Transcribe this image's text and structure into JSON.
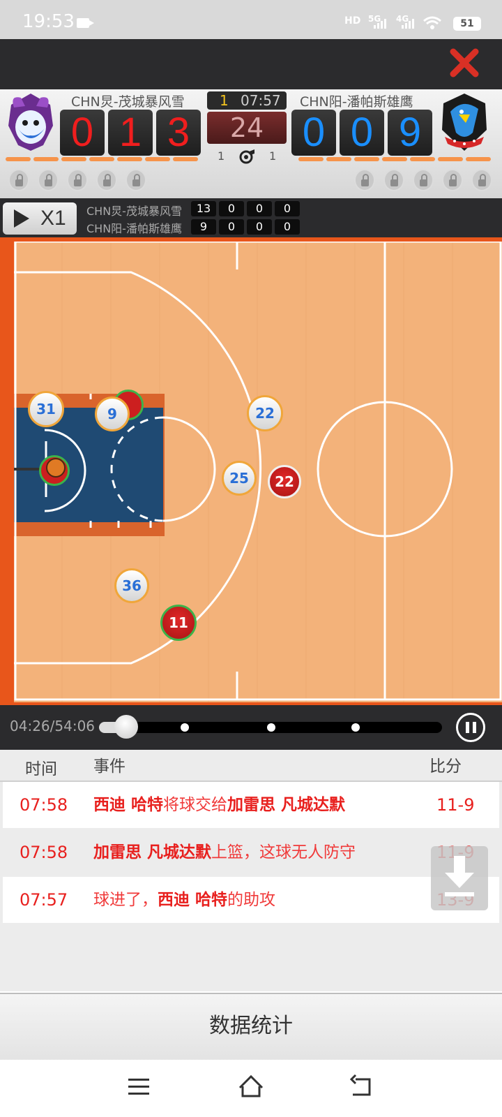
{
  "status_bar": {
    "time": "19:53",
    "hd": "HD",
    "net1": "5G",
    "net2": "4G",
    "battery": "51"
  },
  "header": {
    "close_icon": "close-x-icon"
  },
  "scoreboard": {
    "home": {
      "name": "CHN炅-茂城暴风雪",
      "digits": [
        "0",
        "1",
        "3"
      ],
      "color": "#f01e1e",
      "logo_icon": "purple-wolf-logo-icon"
    },
    "away": {
      "name": "CHN阳-潘帕斯雄鹰",
      "digits": [
        "0",
        "0",
        "9"
      ],
      "color": "#1a8fff",
      "logo_icon": "blue-eagle-logo-icon"
    },
    "quarter": "1",
    "game_clock": "07:57",
    "shot_clock": "24",
    "home_fouls": "1",
    "away_fouls": "1",
    "whistle_icon": "whistle-icon"
  },
  "quarter_scores": {
    "speed_label": "X1",
    "rows": [
      {
        "team": "CHN炅-茂城暴风雪",
        "scores": [
          "13",
          "0",
          "0",
          "0"
        ]
      },
      {
        "team": "CHN阳-潘帕斯雄鹰",
        "scores": [
          "9",
          "0",
          "0",
          "0"
        ]
      }
    ]
  },
  "court": {
    "players": [
      {
        "number": "31",
        "team": "away"
      },
      {
        "number": "9",
        "team": "away"
      },
      {
        "number": "22",
        "team": "away"
      },
      {
        "number": "25",
        "team": "away"
      },
      {
        "number": "22",
        "team": "home"
      },
      {
        "number": "36",
        "team": "away"
      },
      {
        "number": "11",
        "team": "home"
      }
    ]
  },
  "timeline": {
    "time": "04:26/54:06",
    "progress": 0.08
  },
  "events": {
    "headers": {
      "time": "时间",
      "event": "事件",
      "score": "比分"
    },
    "rows": [
      {
        "time": "07:58",
        "p1": "西迪 哈特",
        "t1": "将球交给",
        "p2": "加雷思 凡城达默",
        "t2": "",
        "score": "11-9"
      },
      {
        "time": "07:58",
        "p1": "加雷思 凡城达默",
        "t1": "上篮，这球无人防守",
        "p2": "",
        "t2": "",
        "score": "11-9"
      },
      {
        "time": "07:57",
        "p1": "",
        "t1": "球进了，",
        "p2": "西迪 哈特",
        "t2": "的助攻",
        "score": "13-9"
      }
    ]
  },
  "stats_button": "数据统计",
  "nav": {
    "menu": "menu-icon",
    "home": "home-icon",
    "back": "back-icon"
  }
}
